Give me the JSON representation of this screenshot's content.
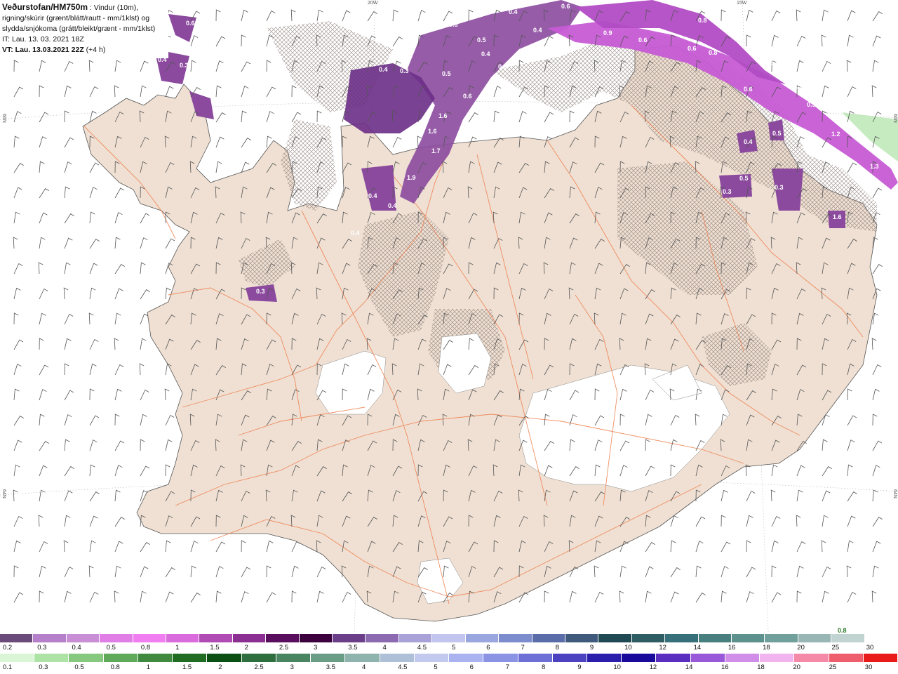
{
  "header": {
    "title": "Veðurstofan/HM750m",
    "title_rest": " : Vindur (10m),",
    "line2": "rigning/skúrir (grænt/blátt/rautt - mm/1klst) og",
    "line3": "slydda/snjókoma (grátt/bleikt/grænt - mm/1klst)",
    "it": "IT: Lau. 13. 03. 2021 18Z",
    "vt": "VT: Lau. 13.03.2021 22Z",
    "vt_offset": " (+4 h)"
  },
  "grid_labels": {
    "top_20w": "20W",
    "top_15w": "15W",
    "left_66n": "66N",
    "left_64n": "64N",
    "right_66n": "66N",
    "right_64n": "64N"
  },
  "map_values": [
    "0.4",
    "0.3",
    "0.6",
    "0.4",
    "0.8",
    "0.5",
    "0.4",
    "0.4",
    "0.3",
    "0.5",
    "0.6",
    "0.5",
    "0.4",
    "0.6",
    "0.9",
    "0.6",
    "0.8",
    "0.6",
    "0.8",
    "0.6",
    "0.5",
    "0.5",
    "0.6",
    "1.2",
    "1.3",
    "1.6",
    "1.6",
    "1.7",
    "1.9",
    "0.4",
    "0.4",
    "0.4",
    "0.3",
    "0.4",
    "0.3",
    "0.5",
    "0.5",
    "0.3",
    "1.6",
    "0.8"
  ],
  "top_value": "0.8",
  "scale_top": {
    "labels": [
      "0.2",
      "0.3",
      "0.4",
      "0.5",
      "0.8",
      "1",
      "1.5",
      "2",
      "2.5",
      "3",
      "3.5",
      "4",
      "4.5",
      "5",
      "6",
      "7",
      "8",
      "9",
      "10",
      "12",
      "14",
      "16",
      "18",
      "20",
      "25",
      "30"
    ],
    "colors": [
      "#6b4b7a",
      "#b57fc9",
      "#c98fd6",
      "#e07ee6",
      "#f07ef0",
      "#d96bdc",
      "#b04bb6",
      "#8c2f92",
      "#5a0f5e",
      "#3d003f",
      "#6b3e8a",
      "#8c6ab2",
      "#a8a2d8",
      "#c2c5ef",
      "#9aa6e0",
      "#7d8ccc",
      "#5b6da8",
      "#3f5a7c",
      "#1f4a54",
      "#2e5e63",
      "#37707a",
      "#49807f",
      "#5c918d",
      "#719f9b",
      "#98b6b3",
      "#c2d4d2",
      "#ffffff"
    ]
  },
  "scale_bottom": {
    "labels": [
      "0.1",
      "0.3",
      "0.5",
      "0.8",
      "1",
      "1.5",
      "2",
      "2.5",
      "3",
      "3.5",
      "4",
      "4.5",
      "5",
      "6",
      "7",
      "8",
      "9",
      "10",
      "12",
      "14",
      "16",
      "18",
      "20",
      "25",
      "30"
    ],
    "colors": [
      "#d9f5d6",
      "#aee3a6",
      "#86c97e",
      "#5ea95a",
      "#3f8a3e",
      "#1f6c22",
      "#0b4f14",
      "#2f6f3f",
      "#4a8562",
      "#6a9d86",
      "#8fb3ad",
      "#aebfd8",
      "#c2c9ef",
      "#aab3ef",
      "#8b93e5",
      "#6d6fd6",
      "#4b42c2",
      "#2a1ead",
      "#1a0a9c",
      "#5a2ec0",
      "#9858d8",
      "#d08ee8",
      "#f2b4ee",
      "#f48aa8",
      "#ef5e6c",
      "#e81a1a"
    ]
  },
  "colors": {
    "land": "#efe0d3",
    "sea": "#ffffff",
    "roads": "#ef7d4a",
    "snow_purple": "#7c3c96",
    "ice": "#ffffff"
  }
}
